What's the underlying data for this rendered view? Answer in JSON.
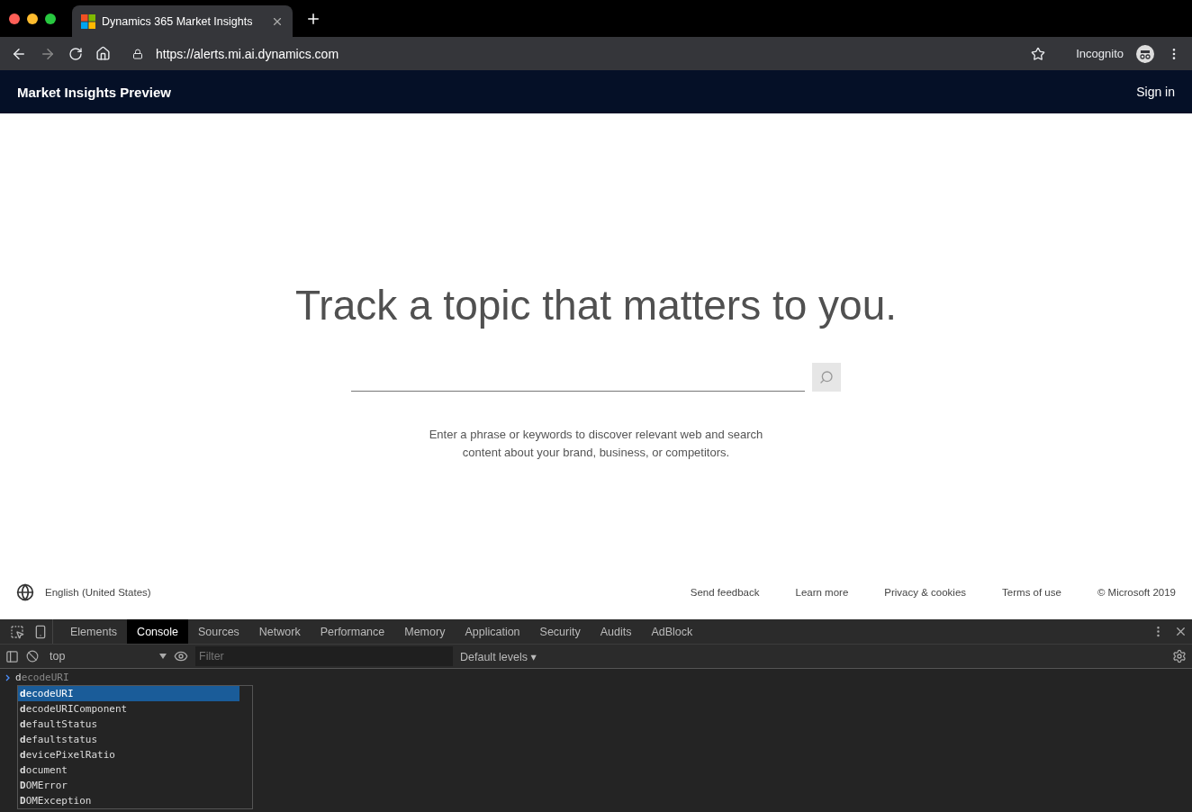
{
  "browser": {
    "tab": {
      "title": "Dynamics 365 Market Insights",
      "selected": true
    },
    "url": "https://alerts.mi.ai.dynamics.com",
    "profile": "Incognito"
  },
  "site": {
    "brand": "Market Insights Preview",
    "sign_in": "Sign in",
    "heading": "Track a topic that matters to you.",
    "description": "Enter a phrase or keywords to discover relevant web and search content about your brand, business, or competitors.",
    "footer": {
      "language": "English (United States)",
      "links": [
        "Send feedback",
        "Learn more",
        "Privacy & cookies",
        "Terms of use",
        "© Microsoft 2019"
      ]
    }
  },
  "devtools": {
    "tabs": [
      {
        "label": "Elements",
        "selected": false
      },
      {
        "label": "Console",
        "selected": true
      },
      {
        "label": "Sources",
        "selected": false
      },
      {
        "label": "Network",
        "selected": false
      },
      {
        "label": "Performance",
        "selected": false
      },
      {
        "label": "Memory",
        "selected": false
      },
      {
        "label": "Application",
        "selected": false
      },
      {
        "label": "Security",
        "selected": false
      },
      {
        "label": "Audits",
        "selected": false
      },
      {
        "label": "AdBlock",
        "selected": false
      }
    ],
    "context": "top",
    "filter": {
      "placeholder": "Filter"
    },
    "levels": "Default levels ▾",
    "input": {
      "value": "d",
      "suggestion": "ecodeURI"
    },
    "autocomplete": [
      {
        "label": "**d**ecodeURI",
        "selected": true
      },
      {
        "label": "**d**ecodeURIComponent",
        "selected": false
      },
      {
        "label": "**d**efaultStatus",
        "selected": false
      },
      {
        "label": "**d**efaultstatus",
        "selected": false
      },
      {
        "label": "**d**evicePixelRatio",
        "selected": false
      },
      {
        "label": "**d**ocument",
        "selected": false
      },
      {
        "label": "**D**OMError",
        "selected": false
      },
      {
        "label": "**D**OMException",
        "selected": false
      }
    ]
  }
}
